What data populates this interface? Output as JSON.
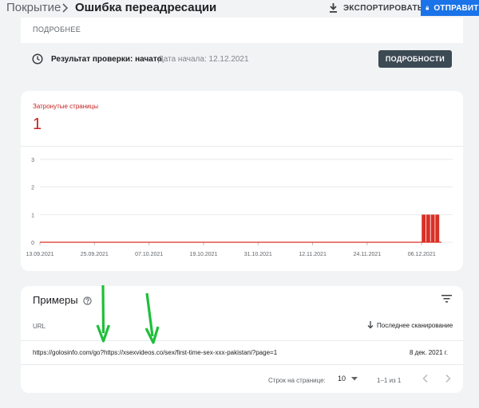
{
  "header": {
    "breadcrumb_parent": "Покрытие",
    "breadcrumb_current": "Ошибка переадресации",
    "export_label": "ЭКСПОРТИРОВАТЬ",
    "send_label": "ОТПРАВИТЬ"
  },
  "validation": {
    "details_header": "ПОДРОБНЕЕ",
    "status_text": "Результат проверки: начато",
    "start_date": "Дата начала: 12.12.2021",
    "details_button": "ПОДРОБНОСТИ"
  },
  "affected": {
    "label": "Затронутые страницы",
    "count": "1"
  },
  "chart_data": {
    "type": "bar",
    "title": "",
    "xlabel": "",
    "ylabel": "",
    "ylim": [
      0,
      3
    ],
    "yticks": [
      "0",
      "1",
      "2",
      "3"
    ],
    "xticks": [
      "13.09.2021",
      "25.09.2021",
      "07.10.2021",
      "19.10.2021",
      "31.10.2021",
      "12.11.2021",
      "24.11.2021",
      "06.12.2021"
    ],
    "x_start": "13.09.2021",
    "x_end": "10.12.2021",
    "series": [
      {
        "color": "#d93025",
        "points": [
          {
            "x": "07.12.2021",
            "y": 1
          },
          {
            "x": "08.12.2021",
            "y": 1
          },
          {
            "x": "09.12.2021",
            "y": 1
          },
          {
            "x": "10.12.2021",
            "y": 1
          }
        ]
      }
    ],
    "baseline_color": "#d93025",
    "grid": true
  },
  "examples": {
    "title": "Примеры",
    "col_url": "URL",
    "col_last_crawl": "Последнее сканирование",
    "rows": [
      {
        "url": "https://golosinfo.com/go?https://xsexvideos.co/sex/first-time-sex-xxx-pakistani?page=1",
        "date": "8 дек. 2021 г."
      }
    ],
    "rows_per_page_label": "Строк на странице:",
    "rows_per_page": "10",
    "range": "1–1 из 1"
  },
  "colors": {
    "accent": "#1a73e8",
    "error": "#d93025",
    "annotation_arrow": "#1fbf3a"
  }
}
